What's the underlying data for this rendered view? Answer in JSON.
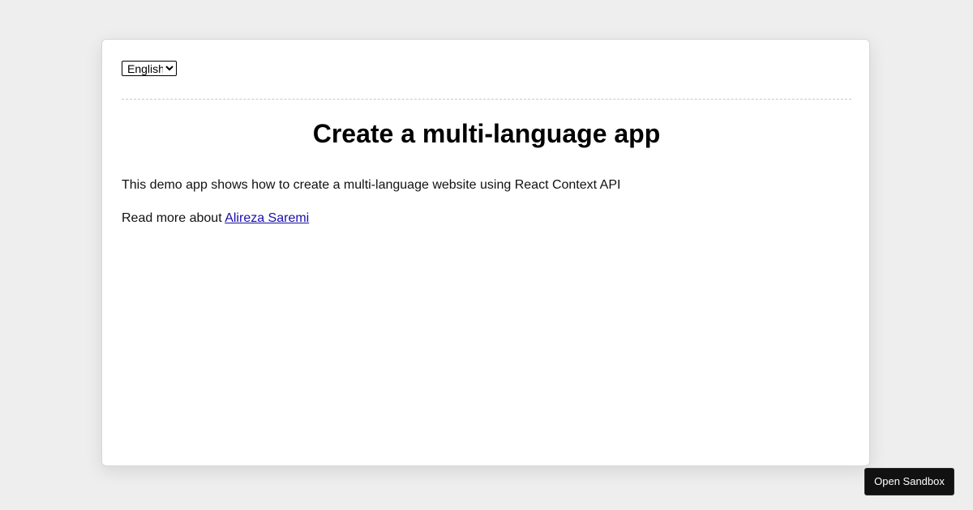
{
  "language_select": {
    "selected": "English"
  },
  "main": {
    "title": "Create a multi-language app",
    "description": "This demo app shows how to create a multi-language website using React Context API",
    "read_more_prefix": "Read more about ",
    "read_more_link": "Alireza Saremi"
  },
  "sandbox": {
    "button_label": "Open Sandbox"
  },
  "colors": {
    "background": "#eeeeee",
    "card": "#ffffff",
    "link": "#1a0dab",
    "button": "#111111"
  }
}
